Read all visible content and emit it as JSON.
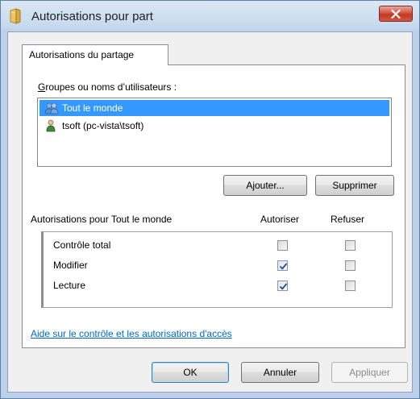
{
  "window": {
    "title": "Autorisations pour part",
    "close_icon": "close-icon"
  },
  "tabs": [
    {
      "label": "Autorisations du partage",
      "selected": true
    }
  ],
  "users_section": {
    "label": "Groupes ou noms d’utilisateurs :",
    "users": [
      {
        "name": "Tout le monde",
        "icon": "group-icon",
        "selected": true
      },
      {
        "name": "tsoft (pc-vista\\tsoft)",
        "icon": "user-icon",
        "selected": false
      }
    ],
    "add_button": "Ajouter...",
    "remove_button": "Supprimer"
  },
  "permissions": {
    "header_label": "Autorisations pour Tout le monde",
    "allow_header": "Autoriser",
    "deny_header": "Refuser",
    "rows": [
      {
        "name": "Contrôle total",
        "allow": false,
        "deny": false
      },
      {
        "name": "Modifier",
        "allow": true,
        "deny": false
      },
      {
        "name": "Lecture",
        "allow": true,
        "deny": false
      }
    ]
  },
  "help_link": "Aide sur le contrôle et les autorisations d'accès",
  "footer": {
    "ok": "OK",
    "cancel": "Annuler",
    "apply": "Appliquer"
  }
}
